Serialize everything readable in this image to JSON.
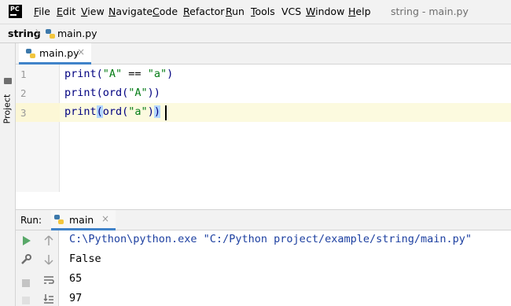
{
  "app": {
    "logo": "PC",
    "window_title": "string - main.py"
  },
  "menu": [
    {
      "label": "File",
      "u": "F",
      "rest": "ile"
    },
    {
      "label": "Edit",
      "u": "E",
      "rest": "dit"
    },
    {
      "label": "View",
      "u": "V",
      "rest": "iew"
    },
    {
      "label": "Navigate",
      "u": "N",
      "rest": "avigate"
    },
    {
      "label": "Code",
      "u": "C",
      "rest": "ode"
    },
    {
      "label": "Refactor",
      "u": "R",
      "rest": "efactor"
    },
    {
      "label": "Run",
      "u": "R",
      "rest": "un"
    },
    {
      "label": "Tools",
      "u": "T",
      "rest": "ools"
    },
    {
      "label": "VCS",
      "u": "",
      "rest": "VCS"
    },
    {
      "label": "Window",
      "u": "W",
      "rest": "indow"
    },
    {
      "label": "Help",
      "u": "H",
      "rest": "elp"
    }
  ],
  "breadcrumb": {
    "project": "string",
    "separator": "〉",
    "file": "main.py"
  },
  "left_strip": {
    "project_tab": "Project"
  },
  "editor_tab": {
    "label": "main.py",
    "close": "×"
  },
  "editor": {
    "line_numbers": [
      "1",
      "2",
      "3"
    ],
    "lines": [
      {
        "a": "print(",
        "s1": "\"A\"",
        "op": " == ",
        "s2": "\"a\"",
        "z": ")"
      },
      {
        "a": "print(ord(",
        "s1": "\"A\"",
        "z": "))"
      },
      {
        "a": "print",
        "b1": "(",
        "c": "ord(",
        "s1": "\"a\"",
        "d": ")",
        "b2": ")"
      }
    ]
  },
  "run": {
    "label": "Run:",
    "tab_label": "main",
    "close": "×",
    "output": [
      "C:\\Python\\python.exe \"C:/Python project/example/string/main.py\"",
      "False",
      "65",
      "97"
    ]
  },
  "colors": {
    "string": "#067d17",
    "keyword": "#000080",
    "accent": "#4083c9",
    "run_green": "#59a869"
  },
  "icons": [
    "python-file-icon",
    "run-icon",
    "wrench-icon",
    "stop-icon",
    "up-arrow-icon",
    "down-arrow-icon",
    "soft-wrap-icon",
    "scroll-to-end-icon",
    "folder-icon",
    "close-icon"
  ]
}
